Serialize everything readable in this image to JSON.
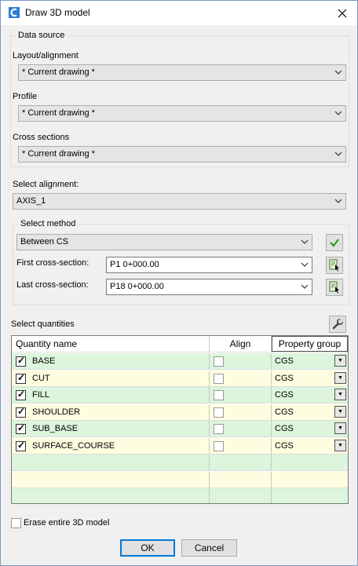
{
  "window": {
    "title": "Draw 3D model"
  },
  "data_source": {
    "legend": "Data source",
    "layout_label": "Layout/alignment",
    "layout_value": "* Current drawing *",
    "profile_label": "Profile",
    "profile_value": "* Current drawing *",
    "cross_sections_label": "Cross sections",
    "cross_sections_value": "* Current drawing *"
  },
  "alignment": {
    "label": "Select alignment:",
    "value": "AXIS_1"
  },
  "method": {
    "legend": "Select method",
    "value": "Between CS",
    "first_label": "First cross-section:",
    "first_value": "P1 0+000.00",
    "last_label": "Last cross-section:",
    "last_value": "P18 0+000.00"
  },
  "quantities": {
    "label": "Select quantities",
    "columns": {
      "name": "Quantity name",
      "align": "Align",
      "group": "Property group"
    },
    "rows": [
      {
        "name": "BASE",
        "checked": true,
        "group": "CGS",
        "color": "#dcf5dc"
      },
      {
        "name": "CUT",
        "checked": true,
        "group": "CGS",
        "color": "#fdfde0"
      },
      {
        "name": "FILL",
        "checked": true,
        "group": "CGS",
        "color": "#dcf5dc"
      },
      {
        "name": "SHOULDER",
        "checked": true,
        "group": "CGS",
        "color": "#fdfde0"
      },
      {
        "name": "SUB_BASE",
        "checked": true,
        "group": "CGS",
        "color": "#dcf5dc"
      },
      {
        "name": "SURFACE_COURSE",
        "checked": true,
        "group": "CGS",
        "color": "#fdfde0"
      }
    ],
    "empty_row_colors": [
      "#dcf5dc",
      "#fdfde0",
      "#dcf5dc"
    ]
  },
  "erase": {
    "label": "Erase entire 3D model",
    "checked": false
  },
  "buttons": {
    "ok": "OK",
    "cancel": "Cancel"
  },
  "colors": {
    "accent": "#0078d7",
    "row_green": "#dcf5dc",
    "row_yellow": "#fdfde0"
  }
}
